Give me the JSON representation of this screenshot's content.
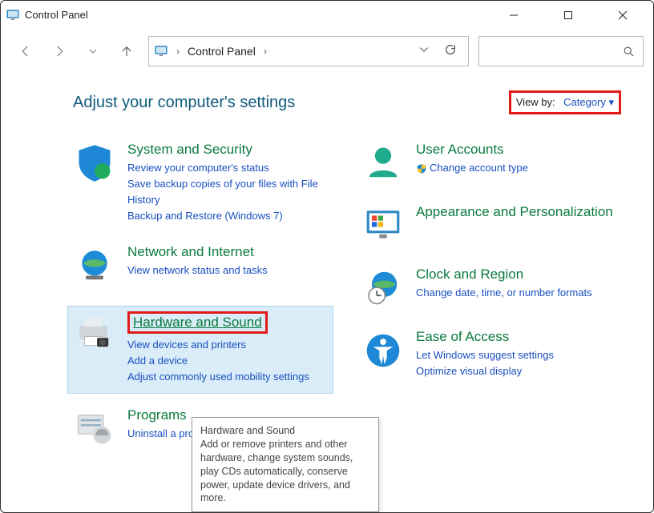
{
  "window": {
    "title": "Control Panel"
  },
  "breadcrumb": {
    "root": "Control Panel"
  },
  "heading": "Adjust your computer's settings",
  "viewby": {
    "label": "View by:",
    "value": "Category ▾"
  },
  "left": {
    "sys": {
      "title": "System and Security",
      "l1": "Review your computer's status",
      "l2": "Save backup copies of your files with File History",
      "l3": "Backup and Restore (Windows 7)"
    },
    "net": {
      "title": "Network and Internet",
      "l1": "View network status and tasks"
    },
    "hw": {
      "title": "Hardware and Sound",
      "l1": "View devices and printers",
      "l2": "Add a device",
      "l3": "Adjust commonly used mobility settings"
    },
    "prog": {
      "title": "Programs",
      "l1": "Uninstall a program"
    }
  },
  "right": {
    "user": {
      "title": "User Accounts",
      "l1": "Change account type"
    },
    "appr": {
      "title": "Appearance and Personalization"
    },
    "clock": {
      "title": "Clock and Region",
      "l1": "Change date, time, or number formats"
    },
    "ease": {
      "title": "Ease of Access",
      "l1": "Let Windows suggest settings",
      "l2": "Optimize visual display"
    }
  },
  "tooltip": {
    "title": "Hardware and Sound",
    "body": "Add or remove printers and other hardware, change system sounds, play CDs automatically, conserve power, update device drivers, and more."
  }
}
